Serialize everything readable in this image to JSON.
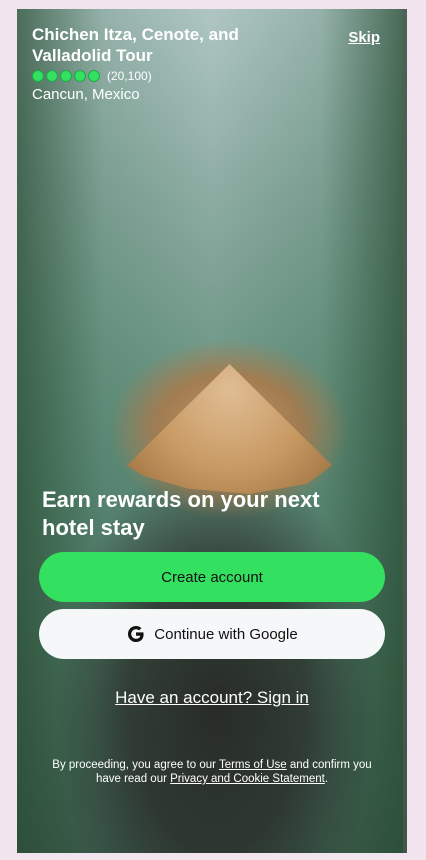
{
  "tour": {
    "title": "Chichen Itza, Cenote, and Valladolid Tour",
    "rating": 5,
    "review_count": "(20,100)",
    "location": "Cancun, Mexico"
  },
  "header": {
    "skip_label": "Skip"
  },
  "promo": {
    "headline": "Earn rewards on your next hotel stay"
  },
  "actions": {
    "create_account_label": "Create account",
    "google_label": "Continue with Google",
    "google_icon": "google-g-icon",
    "signin_label": "Have an account? Sign in"
  },
  "legal": {
    "prefix": "By proceeding, you agree to our ",
    "terms_label": "Terms of Use",
    "middle": " and confirm you have read our ",
    "privacy_label": "Privacy and Cookie Statement",
    "suffix": "."
  },
  "colors": {
    "primary_button": "#34e060",
    "secondary_button": "#f5f7f9",
    "rating_dot": "#34e061",
    "page_background": "#f1e4ef"
  }
}
